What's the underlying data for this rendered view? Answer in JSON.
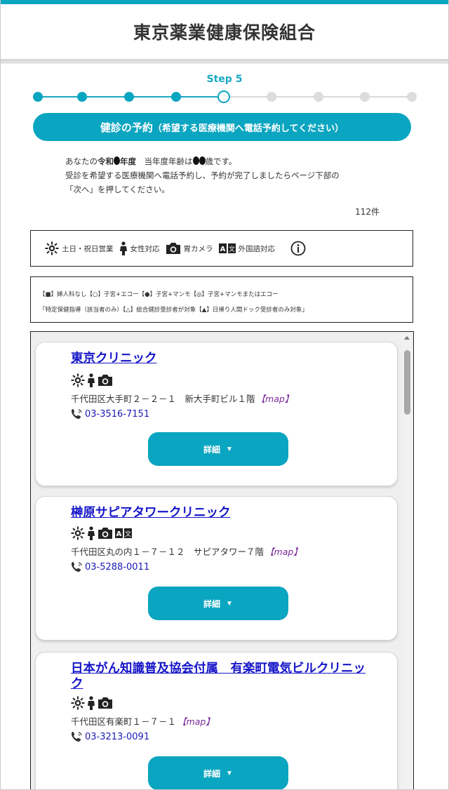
{
  "header": {
    "title": "東京薬業健康保険組合"
  },
  "progress": {
    "step_label": "Step 5",
    "total_steps": 9,
    "current_step": 5
  },
  "banner": {
    "main": "健診の予約",
    "sub": "（希望する医療機関へ電話予約してください）"
  },
  "intro": {
    "line1_a": "あなたの",
    "line1_b": "令和",
    "line1_c": "年度",
    "line1_d": "　当年度年齢は",
    "line1_e": "歳です。",
    "line2": "受診を希望する医療機関へ電話予約し、予約が完了しましたらページ下部の",
    "line3": "「次へ」を押してください。"
  },
  "count": "112件",
  "legend": {
    "weekend": "土日・祝日営業",
    "female": "女性対応",
    "gastro": "胃カメラ",
    "foreign": "外国語対応"
  },
  "notes": {
    "line1": "【■】婦人科なし【○】子宮+エコー【●】子宮+マンモ【◎】子宮+マンモまたはエコー",
    "line2": "「特定保健指導（該当者のみ）【△】総合健診受診者が対象【▲】日帰り人間ドック受診者のみ対象」"
  },
  "clinics": [
    {
      "name": "東京クリニック",
      "address": "千代田区大手町２－２－１　新大手町ビル１階",
      "map": "【map】",
      "phone": "03-3516-7151",
      "detail": "詳細",
      "icons": [
        "sun-icon",
        "female-icon",
        "camera-icon"
      ]
    },
    {
      "name": "榊原サピアタワークリニック",
      "address": "千代田区丸の内１－７－１２　サピアタワー７階",
      "map": "【map】",
      "phone": "03-5288-0011",
      "detail": "詳細",
      "icons": [
        "sun-icon",
        "female-icon",
        "camera-icon",
        "translate-icon"
      ]
    },
    {
      "name": "日本がん知識普及協会付属　有楽町電気ビルクリニック",
      "address": "千代田区有楽町１－７－１",
      "map": "【map】",
      "phone": "03-3213-0091",
      "detail": "詳細",
      "icons": [
        "sun-icon",
        "female-icon",
        "camera-icon"
      ]
    }
  ],
  "colors": {
    "accent": "#0aa5c0",
    "link": "#1515c8",
    "map": "#7a2a9a"
  }
}
